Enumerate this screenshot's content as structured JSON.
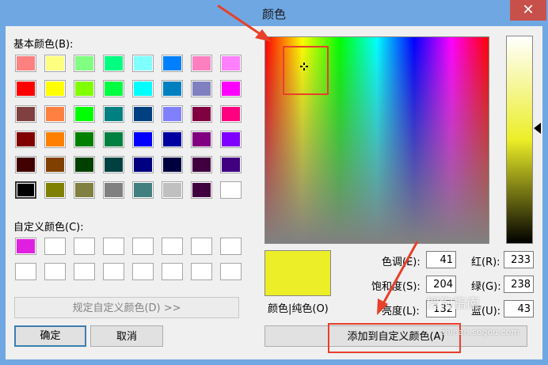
{
  "window": {
    "title": "颜色",
    "close_glyph": "✕"
  },
  "basic_colors": {
    "label": "基本颜色(B):",
    "swatches": [
      "#ff8080",
      "#ffff80",
      "#80ff80",
      "#00ff80",
      "#80ffff",
      "#0080ff",
      "#ff80c0",
      "#ff80ff",
      "#ff0000",
      "#ffff00",
      "#80ff00",
      "#00ff40",
      "#00ffff",
      "#0080c0",
      "#8080c0",
      "#ff00ff",
      "#804040",
      "#ff8040",
      "#00ff00",
      "#008080",
      "#004080",
      "#8080ff",
      "#800040",
      "#ff0080",
      "#800000",
      "#ff8000",
      "#008000",
      "#008040",
      "#0000ff",
      "#0000a0",
      "#800080",
      "#8000ff",
      "#400000",
      "#804000",
      "#004000",
      "#004040",
      "#000080",
      "#000040",
      "#400040",
      "#400080",
      "#000000",
      "#808000",
      "#808040",
      "#808080",
      "#408080",
      "#c0c0c0",
      "#400040",
      "#ffffff"
    ],
    "selected_index": 40
  },
  "custom_colors": {
    "label": "自定义颜色(C):",
    "swatches": [
      "#e01fe0",
      "#ffffff",
      "#ffffff",
      "#ffffff",
      "#ffffff",
      "#ffffff",
      "#ffffff",
      "#ffffff",
      "#ffffff",
      "#ffffff",
      "#ffffff",
      "#ffffff",
      "#ffffff",
      "#ffffff",
      "#ffffff",
      "#ffffff"
    ]
  },
  "buttons": {
    "define_custom": "规定自定义颜色(D) >>",
    "ok": "确定",
    "cancel": "取消",
    "add_custom": "添加到自定义颜色(A)"
  },
  "preview": {
    "label": "颜色|纯色(O)",
    "color": "#ecee27"
  },
  "fields": {
    "hue": {
      "label": "色调(E):",
      "value": "41"
    },
    "sat": {
      "label": "饱和度(S):",
      "value": "204"
    },
    "lum": {
      "label": "亮度(L):",
      "value": "132"
    },
    "red": {
      "label": "红(R):",
      "value": "233"
    },
    "green": {
      "label": "绿(G):",
      "value": "238"
    },
    "blue": {
      "label": "蓝(U):",
      "value": "43"
    }
  },
  "annotations": {
    "color": "#e8402a"
  },
  "watermark": {
    "brand": "搜狗指南",
    "url": "zhinan.sogou.com"
  }
}
